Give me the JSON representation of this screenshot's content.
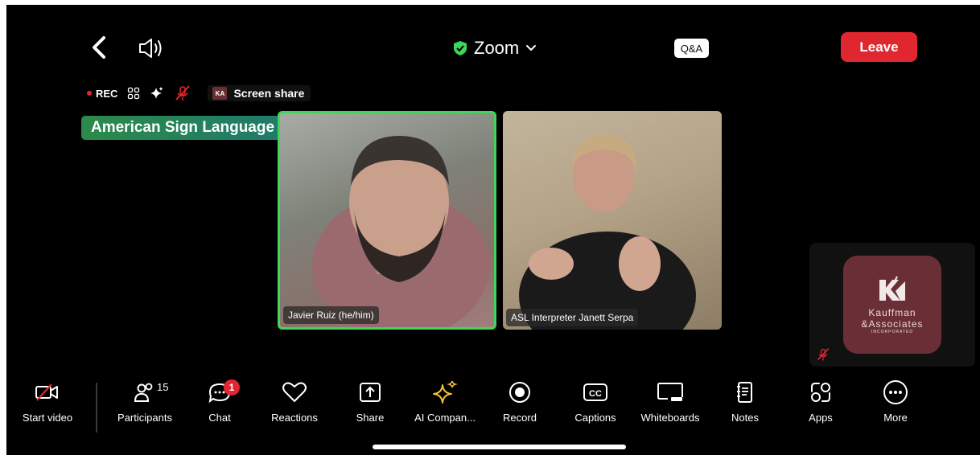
{
  "header": {
    "title": "Zoom",
    "qa_label": "Q&A",
    "leave_label": "Leave"
  },
  "status": {
    "rec_label": "REC",
    "screen_share_label": "Screen share"
  },
  "interpretation_badge": "American Sign Language",
  "tiles": [
    {
      "name": "Javier Ruiz (he/him)",
      "active_speaker": true
    },
    {
      "name": "ASL Interpreter Janett Serpa",
      "active_speaker": false
    }
  ],
  "self_view": {
    "logo_line1": "Kauffman",
    "logo_line2": "&Associates",
    "logo_line3": "INCORPORATED",
    "muted": true
  },
  "toolbar": {
    "items": [
      {
        "label": "Start video",
        "icon": "video-off-icon"
      },
      {
        "label": "Participants",
        "icon": "participants-icon",
        "count": "15"
      },
      {
        "label": "Chat",
        "icon": "chat-icon",
        "badge": "1"
      },
      {
        "label": "Reactions",
        "icon": "heart-icon"
      },
      {
        "label": "Share",
        "icon": "share-icon"
      },
      {
        "label": "AI Compan...",
        "icon": "sparkle-icon"
      },
      {
        "label": "Record",
        "icon": "record-icon"
      },
      {
        "label": "Captions",
        "icon": "captions-icon"
      },
      {
        "label": "Whiteboards",
        "icon": "whiteboard-icon"
      },
      {
        "label": "Notes",
        "icon": "notes-icon"
      },
      {
        "label": "Apps",
        "icon": "apps-icon"
      },
      {
        "label": "More",
        "icon": "more-icon"
      }
    ]
  },
  "colors": {
    "leave": "#e0262f",
    "shield": "#3fd65a",
    "ai_sparkle": "#f2c230",
    "logo_bg": "#6a2f36"
  }
}
